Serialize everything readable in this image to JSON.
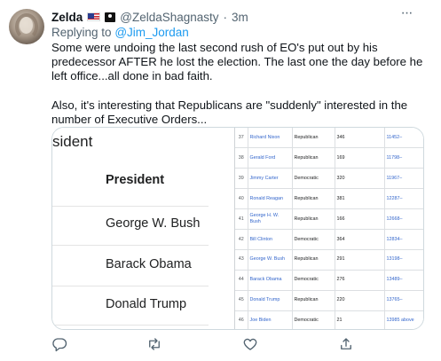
{
  "tweet": {
    "name": "Zelda",
    "handle": "@ZeldaShagnasty",
    "separator": "·",
    "time": "3m",
    "more_label": "···",
    "replying_prefix": "Replying to",
    "replying_to": "@Jim_Jordan",
    "paragraph_1": "Some were undoing the last second rush of EO's put out by his predecessor AFTER he lost the election. The last one the day before he left office...all done in bad faith.",
    "paragraph_2": "Also, it's interesting that Republicans are \"suddenly\" interested in the number of Executive Orders..."
  },
  "media": {
    "left": {
      "title_fragment": "sident",
      "column_header": "President",
      "names": [
        "George W. Bush",
        "Barack Obama",
        "Donald Trump"
      ]
    },
    "table_rows": [
      {
        "num": "37",
        "president": "Richard Nixon",
        "party": "Republican",
        "total": "346",
        "range": "11452–"
      },
      {
        "num": "38",
        "president": "Gerald Ford",
        "party": "Republican",
        "total": "169",
        "range": "11798–"
      },
      {
        "num": "39",
        "president": "Jimmy Carter",
        "party": "Democratic",
        "total": "320",
        "range": "11967–"
      },
      {
        "num": "40",
        "president": "Ronald Reagan",
        "party": "Republican",
        "total": "381",
        "range": "12287–"
      },
      {
        "num": "41",
        "president": "George H. W. Bush",
        "party": "Republican",
        "total": "166",
        "range": "12668–"
      },
      {
        "num": "42",
        "president": "Bill Clinton",
        "party": "Democratic",
        "total": "364",
        "range": "12834–"
      },
      {
        "num": "43",
        "president": "George W. Bush",
        "party": "Republican",
        "total": "291",
        "range": "13198–"
      },
      {
        "num": "44",
        "president": "Barack Obama",
        "party": "Democratic",
        "total": "276",
        "range": "13489–"
      },
      {
        "num": "45",
        "president": "Donald Trump",
        "party": "Republican",
        "total": "220",
        "range": "13765–"
      },
      {
        "num": "46",
        "president": "Joe Biden",
        "party": "Democratic",
        "total": "21",
        "range": "13985 above"
      }
    ]
  },
  "icons": [
    "verified-flag-icon",
    "pirate-flag-icon",
    "more-icon",
    "reply-icon",
    "retweet-icon",
    "like-icon",
    "share-icon"
  ],
  "colors": {
    "link": "#1d9bf0",
    "secondary_text": "#536471",
    "wiki_link": "#3366cc"
  }
}
